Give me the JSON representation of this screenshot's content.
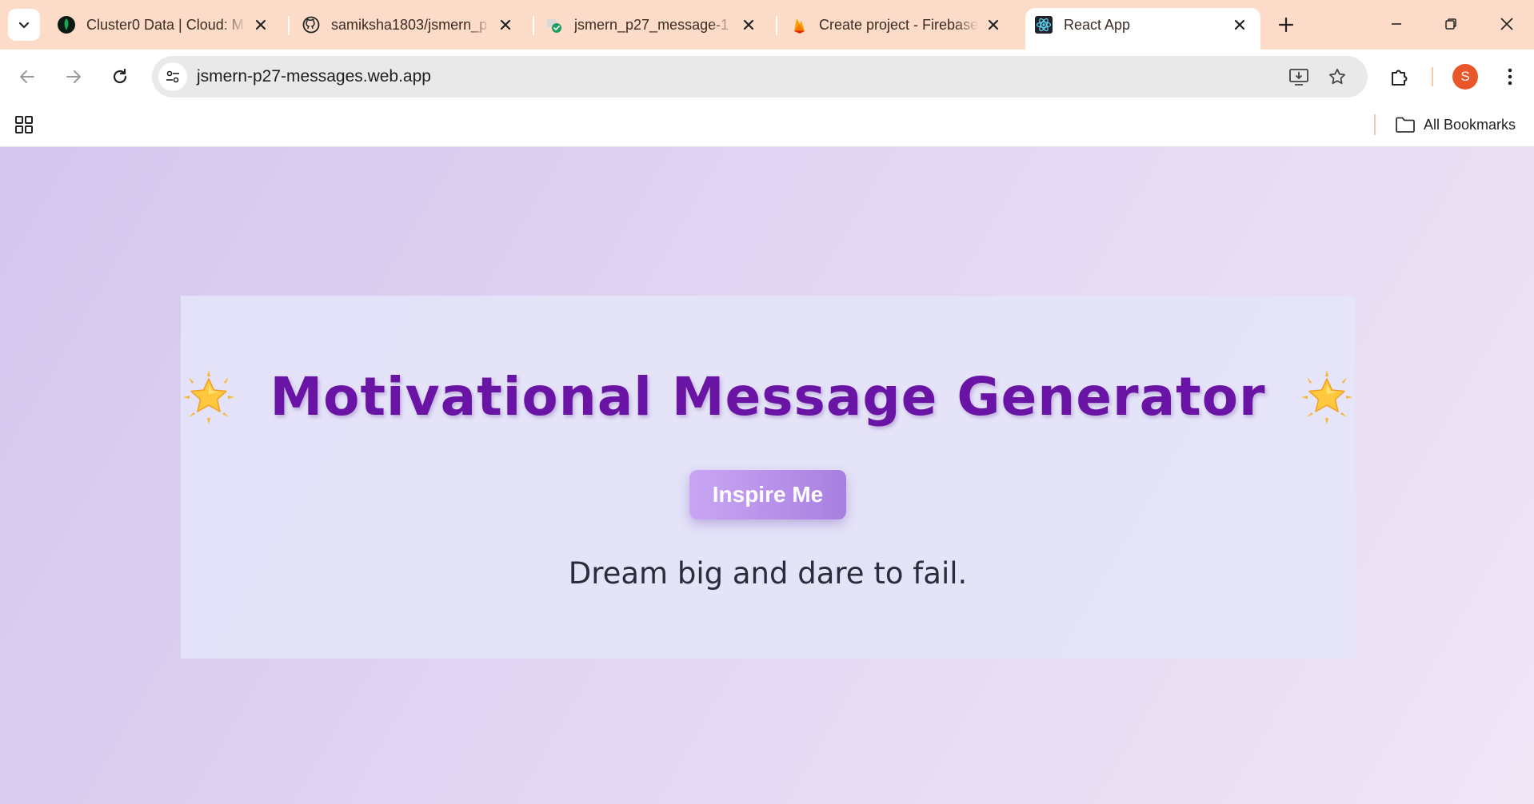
{
  "browser": {
    "tabs": [
      {
        "title": "Cluster0 Data | Cloud: M",
        "icon": "mongodb-leaf-icon",
        "active": false
      },
      {
        "title": "samiksha1803/jsmern_p",
        "icon": "github-icon",
        "active": false
      },
      {
        "title": "jsmern_p27_message-1",
        "icon": "deploy-check-icon",
        "active": false
      },
      {
        "title": "Create project - Firebase",
        "icon": "firebase-flame-icon",
        "active": false
      },
      {
        "title": "React App",
        "icon": "react-atom-icon",
        "active": true
      }
    ],
    "url": "jsmern-p27-messages.web.app",
    "profile_initial": "S",
    "bookmarks_label": "All Bookmarks",
    "colors": {
      "tabstrip": "#fcdcc9",
      "avatar": "#e8562a"
    }
  },
  "page": {
    "emoji_left": "🌟",
    "title": "Motivational Message Generator",
    "emoji_right": "🌟",
    "button_label": "Inspire Me",
    "message": "Dream big and dare to fail.",
    "colors": {
      "title": "#6a14a6",
      "button": "#b48cea",
      "card": "#e4e4f8"
    }
  }
}
